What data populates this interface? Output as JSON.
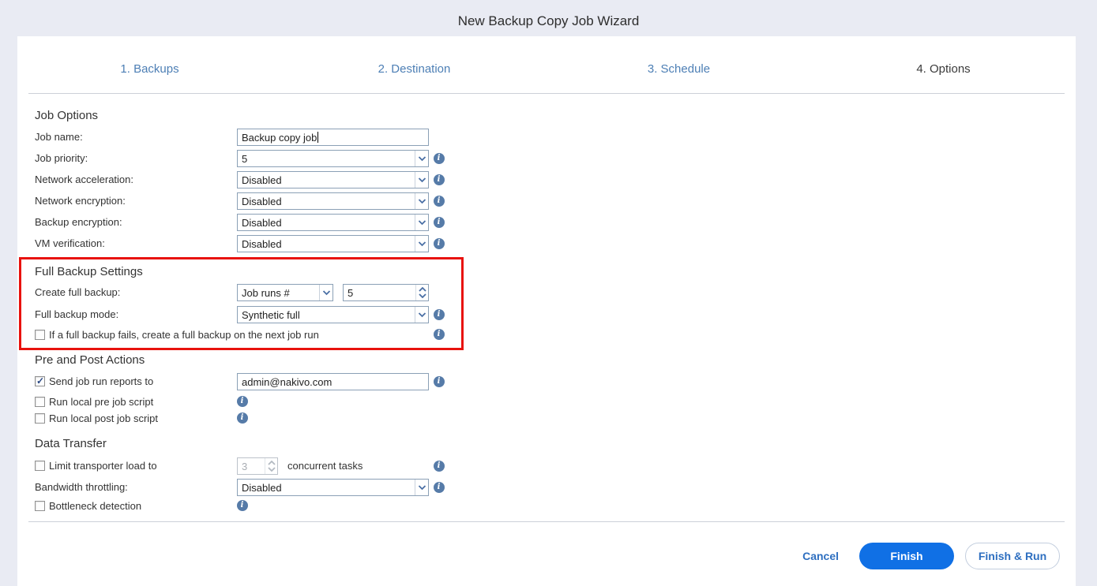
{
  "wizard": {
    "title": "New Backup Copy Job Wizard"
  },
  "tabs": [
    {
      "label": "1. Backups",
      "active": false
    },
    {
      "label": "2. Destination",
      "active": false
    },
    {
      "label": "3. Schedule",
      "active": false
    },
    {
      "label": "4. Options",
      "active": true
    }
  ],
  "job_options": {
    "heading": "Job Options",
    "job_name_label": "Job name:",
    "job_name_value": "Backup copy job",
    "job_priority_label": "Job priority:",
    "job_priority_value": "5",
    "network_acceleration_label": "Network acceleration:",
    "network_acceleration_value": "Disabled",
    "network_encryption_label": "Network encryption:",
    "network_encryption_value": "Disabled",
    "backup_encryption_label": "Backup encryption:",
    "backup_encryption_value": "Disabled",
    "vm_verification_label": "VM verification:",
    "vm_verification_value": "Disabled"
  },
  "full_backup_settings": {
    "heading": "Full Backup Settings",
    "create_full_backup_label": "Create full backup:",
    "create_full_backup_mode": "Job runs #",
    "create_full_backup_count": "5",
    "full_backup_mode_label": "Full backup mode:",
    "full_backup_mode_value": "Synthetic full",
    "fail_checkbox_label": "If a full backup fails, create a full backup on the next job run",
    "fail_checkbox_checked": false
  },
  "pre_post_actions": {
    "heading": "Pre and Post Actions",
    "send_reports_label": "Send job run reports to",
    "send_reports_value": "admin@nakivo.com",
    "send_reports_checked": true,
    "pre_script_label": "Run local pre job script",
    "pre_script_checked": false,
    "post_script_label": "Run local post job script",
    "post_script_checked": false
  },
  "data_transfer": {
    "heading": "Data Transfer",
    "limit_label": "Limit transporter load to",
    "limit_value": "3",
    "limit_suffix": "concurrent tasks",
    "limit_checked": false,
    "limit_enabled": false,
    "bandwidth_label": "Bandwidth throttling:",
    "bandwidth_value": "Disabled",
    "bottleneck_label": "Bottleneck detection",
    "bottleneck_checked": false
  },
  "footer": {
    "cancel_label": "Cancel",
    "finish_label": "Finish",
    "finish_run_label": "Finish & Run"
  },
  "icons": {
    "info": "i-circle",
    "chevron_down": "v",
    "spinner_up": "^",
    "spinner_down": "v",
    "checkmark": "✓"
  },
  "colors": {
    "page_background": "#e9ebf3",
    "panel_background": "#ffffff",
    "tab_link_blue": "#4d7fb5",
    "active_tab_text": "#3a3a3a",
    "field_border": "#8ba0b6",
    "info_icon_blue": "#567ba8",
    "chevron_blue": "#4a6fa5",
    "highlight_red": "#e8120e",
    "primary_button_blue": "#1070e5",
    "link_blue": "#2e6fc0",
    "check_navy": "#2b4a85"
  }
}
